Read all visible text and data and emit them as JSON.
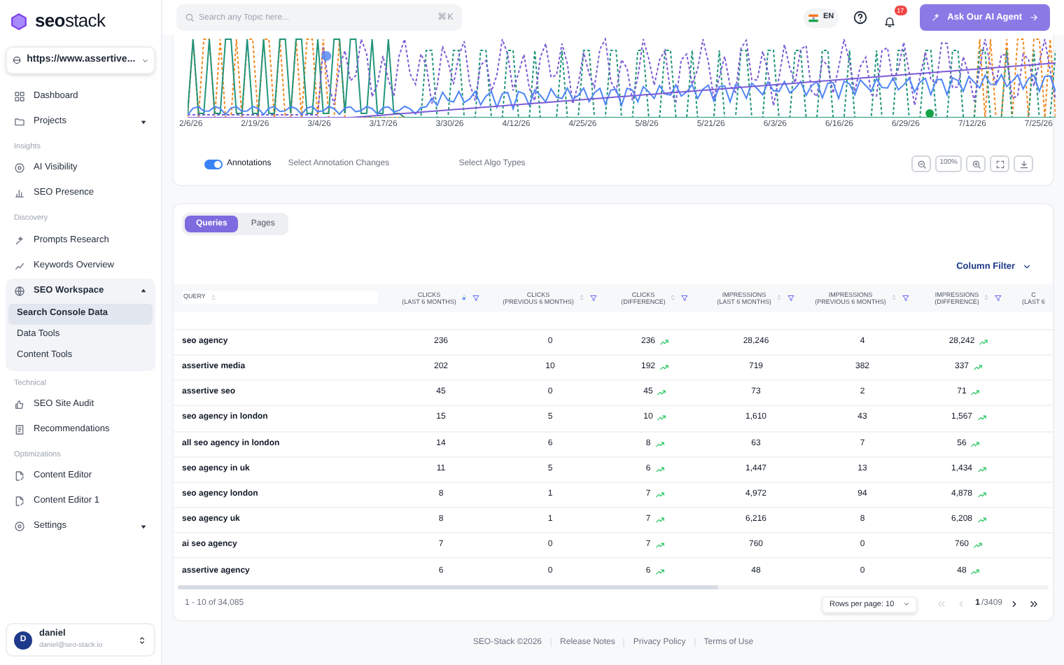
{
  "sidebar": {
    "logo": "**seo**stack",
    "site_selector": "https://www.assertive...",
    "groups": [
      {
        "items": [
          {
            "label": "Dashboard"
          },
          {
            "label": "Projects",
            "expanded": false
          }
        ]
      },
      {
        "heading": "Insights",
        "items": [
          {
            "label": "AI Visibility"
          },
          {
            "label": "SEO Presence"
          }
        ]
      },
      {
        "heading": "Discovery",
        "items": [
          {
            "label": "Prompts Research"
          },
          {
            "label": "Keywords Overview"
          },
          {
            "label": "SEO Workspace",
            "expanded": true,
            "children": [
              {
                "label": "Search Console Data",
                "selected": true
              },
              {
                "label": "Data Tools",
                "selected": false
              },
              {
                "label": "Content Tools",
                "selected": false
              }
            ]
          }
        ]
      },
      {
        "heading": "Technical",
        "items": [
          {
            "label": "SEO Site Audit"
          },
          {
            "label": "Recommendations"
          }
        ]
      },
      {
        "heading": "Optimizations",
        "items": [
          {
            "label": "Content Editor"
          },
          {
            "label": "Content Editor 1"
          },
          {
            "label": "Settings",
            "expanded": false
          }
        ]
      }
    ],
    "user": {
      "initial": "D",
      "name": "daniel",
      "email": "daniel@seo-stack.io"
    }
  },
  "topbar": {
    "search_placeholder": "Search any Topic here...",
    "shortcut": "⌘K",
    "language": "EN",
    "notification_count": "17",
    "ai_button": "Ask Our AI Agent"
  },
  "chart": {
    "x_labels": [
      "2/6/26",
      "2/19/26",
      "3/4/26",
      "3/17/26",
      "3/30/26",
      "4/12/26",
      "4/25/26",
      "5/8/26",
      "5/21/26",
      "6/3/26",
      "6/16/26",
      "6/29/26",
      "7/12/26",
      "7/25/26"
    ]
  },
  "annotations": {
    "on": true,
    "label": "Annotations",
    "change_select": "Select Annotation Changes",
    "algo_select": "Select Algo Types",
    "zoom_level": "100%"
  },
  "tabs": [
    {
      "label": "Queries",
      "selected": true
    },
    {
      "label": "Pages",
      "selected": false
    }
  ],
  "column_filter": "Column Filter",
  "table": {
    "columns": [
      {
        "kind": "text",
        "title": "QUERY",
        "sorted": false
      },
      {
        "kind": "number",
        "title": "CLICKS",
        "subtitle": "(LAST 6 MONTHS)",
        "sorted": true,
        "filter": true
      },
      {
        "kind": "number",
        "title": "CLICKS",
        "subtitle": "(PREVIOUS 6 MONTHS)",
        "sorted": false,
        "filter": true
      },
      {
        "kind": "difference",
        "title": "CLICKS",
        "subtitle": "(DIFFERENCE)",
        "sorted": false,
        "filter": true
      },
      {
        "kind": "number",
        "title": "IMPRESSIONS",
        "subtitle": "(LAST 6 MONTHS)",
        "sorted": false,
        "filter": true
      },
      {
        "kind": "number",
        "title": "IMPRESSIONS",
        "subtitle": "(PREVIOUS 6 MONTHS)",
        "sorted": false,
        "filter": true
      },
      {
        "kind": "difference",
        "title": "IMPRESSIONS",
        "subtitle": "(DIFFERENCE)",
        "sorted": false,
        "filter": true
      },
      {
        "kind": "partial",
        "title": "C",
        "subtitle": "(LAST 6"
      }
    ],
    "rows": [
      [
        "seo agency",
        "236",
        "0",
        "236",
        "28,246",
        "4",
        "28,242"
      ],
      [
        "assertive media",
        "202",
        "10",
        "192",
        "719",
        "382",
        "337"
      ],
      [
        "assertive seo",
        "45",
        "0",
        "45",
        "73",
        "2",
        "71"
      ],
      [
        "seo agency in london",
        "15",
        "5",
        "10",
        "1,610",
        "43",
        "1,567"
      ],
      [
        "all seo agency in london",
        "14",
        "6",
        "8",
        "63",
        "7",
        "56"
      ],
      [
        "seo agency in uk",
        "11",
        "5",
        "6",
        "1,447",
        "13",
        "1,434"
      ],
      [
        "seo agency london",
        "8",
        "1",
        "7",
        "4,972",
        "94",
        "4,878"
      ],
      [
        "seo agency uk",
        "8",
        "1",
        "7",
        "6,216",
        "8",
        "6,208"
      ],
      [
        "ai seo agency",
        "7",
        "0",
        "7",
        "760",
        "0",
        "760"
      ],
      [
        "assertive agency",
        "6",
        "0",
        "6",
        "48",
        "0",
        "48"
      ]
    ]
  },
  "pagination": {
    "range": "1 - 10 of 34,085",
    "rows_per_page": "Rows per page: 10",
    "page": "1",
    "total": "/3409"
  },
  "footer": [
    "SEO-Stack ©2026",
    "Release Notes",
    "Privacy Policy",
    "Terms of Use"
  ]
}
